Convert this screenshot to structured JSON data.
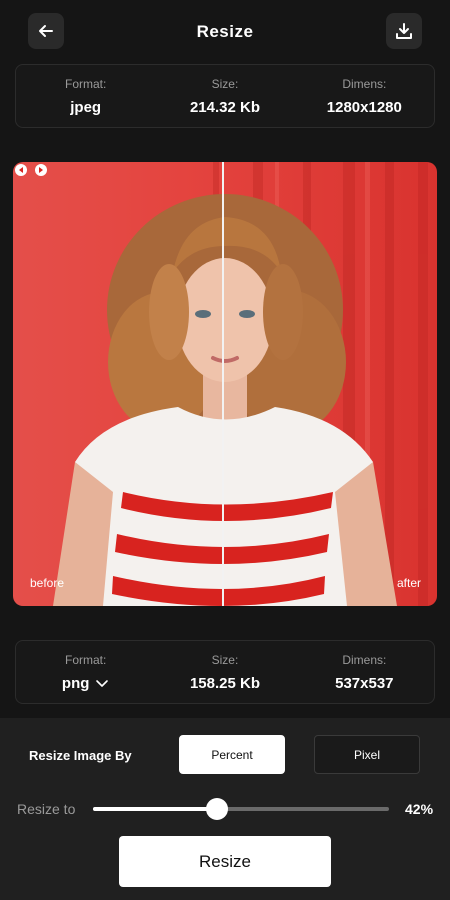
{
  "header": {
    "title": "Resize",
    "back_icon": "arrow-left-icon",
    "download_icon": "download-icon"
  },
  "original_info": {
    "format_label": "Format:",
    "format_value": "jpeg",
    "size_label": "Size:",
    "size_value": "214.32 Kb",
    "dimens_label": "Dimens:",
    "dimens_value": "1280x1280"
  },
  "comparison": {
    "before_label": "before",
    "after_label": "after"
  },
  "result_info": {
    "format_label": "Format:",
    "format_value": "png",
    "size_label": "Size:",
    "size_value": "158.25 Kb",
    "dimens_label": "Dimens:",
    "dimens_value": "537x537"
  },
  "controls": {
    "resize_by_label": "Resize Image By",
    "option_percent": "Percent",
    "option_pixel": "Pixel",
    "selected_option": "Percent",
    "resize_to_label": "Resize to",
    "percent_text": "42%",
    "slider_fraction": 0.42,
    "resize_button": "Resize"
  },
  "colors": {
    "background": "#151515",
    "panel": "#202020",
    "photo_background": "#e4443f"
  }
}
